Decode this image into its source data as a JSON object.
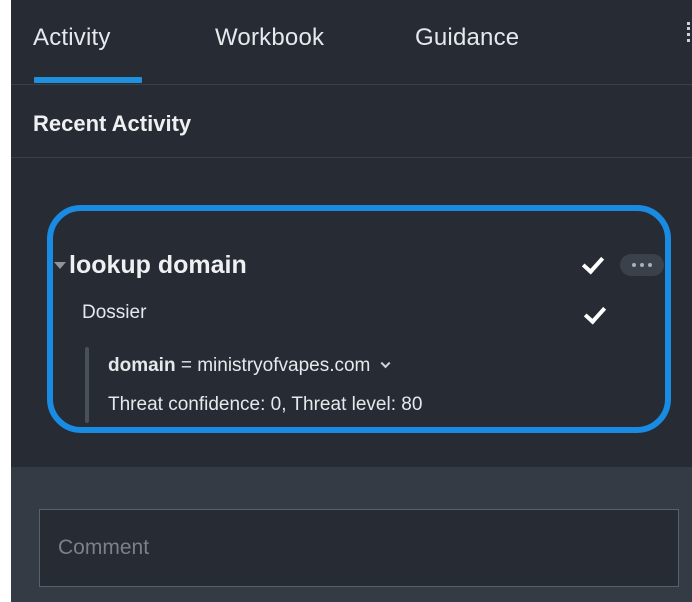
{
  "tabs": [
    {
      "label": "Activity",
      "active": true
    },
    {
      "label": "Workbook",
      "active": false
    },
    {
      "label": "Guidance",
      "active": false
    }
  ],
  "section": {
    "title": "Recent Activity"
  },
  "activity": {
    "action_name": "lookup domain",
    "app_name": "Dossier",
    "parameter": {
      "key": "domain",
      "separator": " = ",
      "value": "ministryofvapes.com"
    },
    "result_message": "Threat confidence: 0, Threat level: 80",
    "status_icon": "check-icon"
  },
  "comment": {
    "placeholder": "Comment",
    "value": ""
  },
  "colors": {
    "panel_background": "#262b34",
    "accent": "#1f8fe0",
    "highlight_ring": "#1a8be3",
    "comment_area": "#353b44"
  }
}
